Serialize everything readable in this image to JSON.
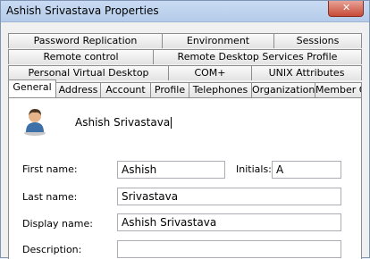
{
  "window": {
    "title": "Ashish Srivastava Properties"
  },
  "tabs": {
    "row1": [
      "Password Replication",
      "Environment",
      "Sessions"
    ],
    "row2": [
      "Remote control",
      "Remote Desktop Services Profile"
    ],
    "row3": [
      "Personal Virtual Desktop",
      "COM+",
      "UNIX Attributes"
    ],
    "row4": [
      "General",
      "Address",
      "Account",
      "Profile",
      "Telephones",
      "Organization",
      "Member Of"
    ],
    "active": "General"
  },
  "general": {
    "display_name_header": "Ashish Srivastava",
    "first_name_label": "First name:",
    "first_name": "Ashish",
    "initials_label": "Initials:",
    "initials": "A",
    "last_name_label": "Last name:",
    "last_name": "Srivastava",
    "display_name_label": "Display name:",
    "display_name": "Ashish Srivastava",
    "description_label": "Description:",
    "description": ""
  }
}
